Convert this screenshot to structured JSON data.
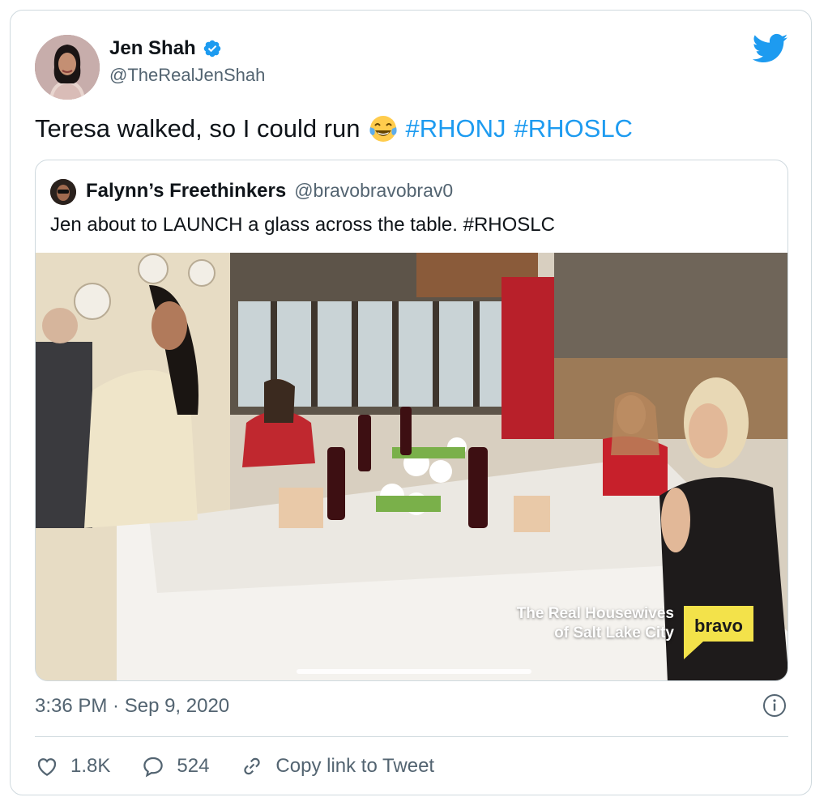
{
  "author": {
    "display_name": "Jen Shah",
    "handle": "@TheRealJenShah",
    "verified_icon": "verified-badge-icon"
  },
  "tweet": {
    "text": "Teresa walked, so I could run",
    "emoji": "face-with-tears-of-joy",
    "hashtags": [
      "#RHONJ",
      "#RHOSLC"
    ]
  },
  "quoted": {
    "display_name": "Falynn’s Freethinkers",
    "handle": "@bravobravobrav0",
    "text": "Jen about to LAUNCH a glass across the table. #RHOSLC",
    "media_watermark_line1": "The Real Housewives",
    "media_watermark_line2": "of Salt Lake City",
    "media_logo_text": "bravo"
  },
  "meta": {
    "timestamp": "3:36 PM · Sep 9, 2020"
  },
  "actions": {
    "like_count": "1.8K",
    "reply_count": "524",
    "copy_link_label": "Copy link to Tweet"
  },
  "colors": {
    "accent": "#1d9bf0",
    "text": "#0f1419",
    "muted": "#536471",
    "border": "#cfd9de"
  }
}
